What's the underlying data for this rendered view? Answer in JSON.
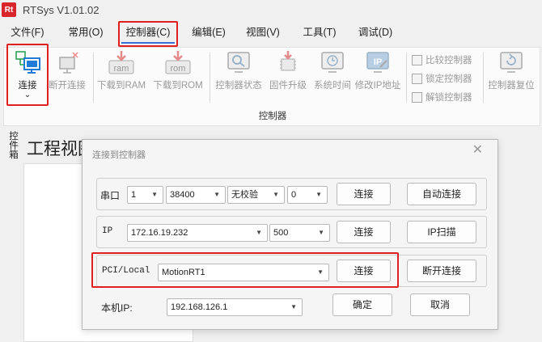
{
  "app": {
    "logo_text": "Rt",
    "title": "RTSys V1.01.02"
  },
  "menu": [
    "文件(F)",
    "常用(O)",
    "控制器(C)",
    "编辑(E)",
    "视图(V)",
    "工具(T)",
    "调试(D)"
  ],
  "ribbon": {
    "connect": "连接",
    "connect_arrow": "⌄",
    "disconnect": "断开连接",
    "download_ram": "下载到RAM",
    "download_ram_icon_text": "ram",
    "download_rom": "下载到ROM",
    "download_rom_icon_text": "rom",
    "controller_status": "控制器状态",
    "firmware_upgrade": "固件升级",
    "system_time": "系统时间",
    "modify_ip": "修改IP地址",
    "modify_ip_icon_text": "IP",
    "compare_controller": "比较控制器",
    "lock_controller": "锁定控制器",
    "unlock_controller": "解锁控制器",
    "controller_reset": "控制器复位",
    "group_label": "控制器"
  },
  "side_tab": "控件箱",
  "workspace_title": "工程视图",
  "dialog": {
    "title": "连接到控制器",
    "close": "✕",
    "serial": {
      "label": "串口",
      "port": "1",
      "baud": "38400",
      "parity": "无校验",
      "extra": "0",
      "connect": "连接",
      "auto_connect": "自动连接"
    },
    "ip": {
      "label": "IP",
      "address": "172.16.19.232",
      "timeout": "500",
      "connect": "连接",
      "scan": "IP扫描"
    },
    "pci": {
      "label": "PCI/Local",
      "device": "MotionRT1",
      "connect": "连接",
      "disconnect": "断开连接"
    },
    "local_ip": {
      "label": "本机IP:",
      "address": "192.168.126.1"
    },
    "ok": "确定",
    "cancel": "取消"
  },
  "colors": {
    "highlight_red": "#e02020",
    "active_tab_underline": "#3a6fd8",
    "connect_icon_blue": "#1f7bd6"
  }
}
